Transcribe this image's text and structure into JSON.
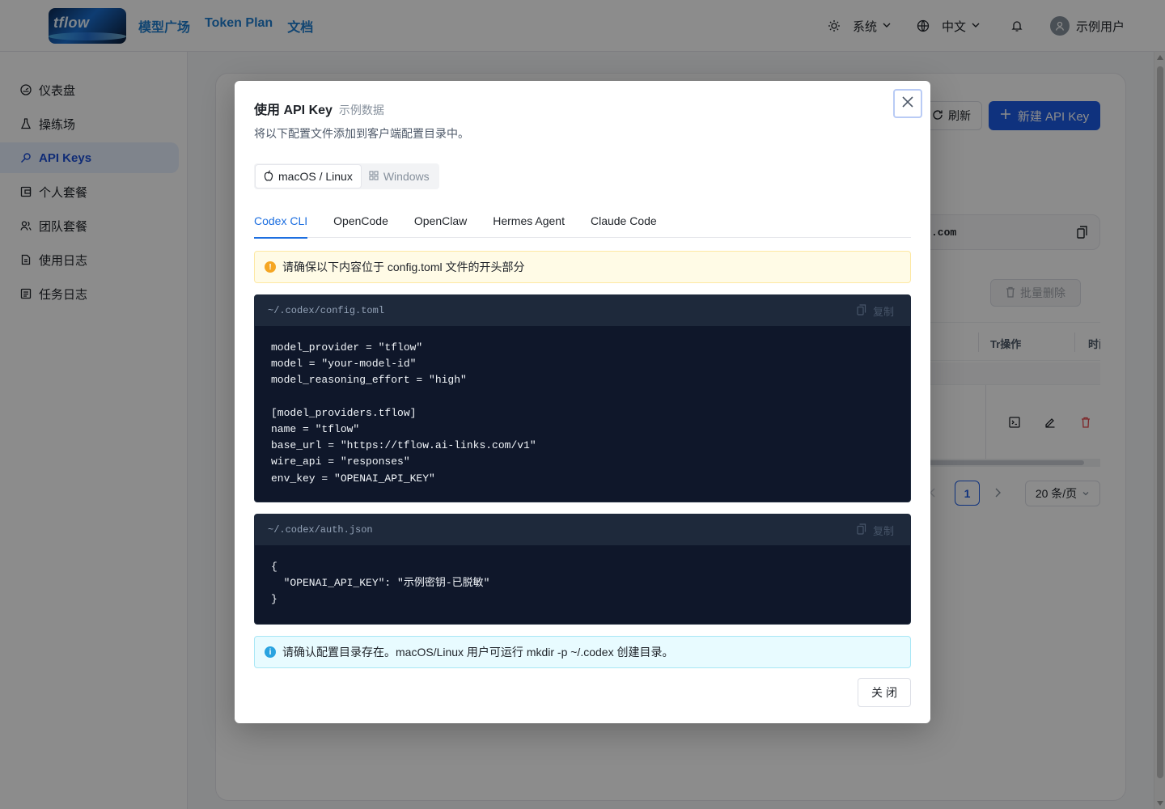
{
  "header": {
    "logo_text": "tflow",
    "nav": [
      "模型广场",
      "Token Plan",
      "文档"
    ],
    "theme_label": "系统",
    "lang_label": "中文",
    "user_name": "示例用户"
  },
  "sidebar": {
    "items": [
      {
        "label": "仪表盘",
        "icon": "dashboard-icon"
      },
      {
        "label": "操练场",
        "icon": "flask-icon"
      },
      {
        "label": "API Keys",
        "icon": "key-icon",
        "active": true
      },
      {
        "label": "个人套餐",
        "icon": "wallet-icon"
      },
      {
        "label": "团队套餐",
        "icon": "team-icon"
      },
      {
        "label": "使用日志",
        "icon": "document-icon"
      },
      {
        "label": "任务日志",
        "icon": "list-icon"
      }
    ]
  },
  "page": {
    "refresh_label": "刷新",
    "new_key_label": "新建 API Key",
    "base_url_fragment": ".com",
    "bulk_delete_label": "批量删除",
    "col_operations": "Tr操作",
    "col_time": "时间",
    "current_page": "1",
    "page_size": "20 条/页"
  },
  "modal": {
    "title": "使用 API Key",
    "subtitle": "示例数据",
    "description": "将以下配置文件添加到客户端配置目录中。",
    "os_options": [
      {
        "label": "macOS / Linux",
        "icon": "apple-icon",
        "active": true
      },
      {
        "label": "Windows",
        "icon": "windows-icon",
        "active": false
      }
    ],
    "tabs": [
      "Codex CLI",
      "OpenCode",
      "OpenClaw",
      "Hermes Agent",
      "Claude Code"
    ],
    "active_tab": "Codex CLI",
    "warning": "请确保以下内容位于 config.toml 文件的开头部分",
    "files": [
      {
        "path": "~/.codex/config.toml",
        "copy_label": "复制",
        "content": "model_provider = \"tflow\"\nmodel = \"your-model-id\"\nmodel_reasoning_effort = \"high\"\n\n[model_providers.tflow]\nname = \"tflow\"\nbase_url = \"https://tflow.ai-links.com/v1\"\nwire_api = \"responses\"\nenv_key = \"OPENAI_API_KEY\""
      },
      {
        "path": "~/.codex/auth.json",
        "copy_label": "复制",
        "content": "{\n  \"OPENAI_API_KEY\": \"示例密钥-已脱敏\"\n}"
      }
    ],
    "info": "请确认配置目录存在。macOS/Linux 用户可运行 mkdir -p ~/.codex 创建目录。",
    "close_label": "关闭"
  },
  "colors": {
    "primary": "#1d5ce6",
    "tab_active": "#1d6fe0",
    "code_bg": "#0f172a",
    "warn": "#f5a623",
    "info": "#2aa3e0"
  }
}
